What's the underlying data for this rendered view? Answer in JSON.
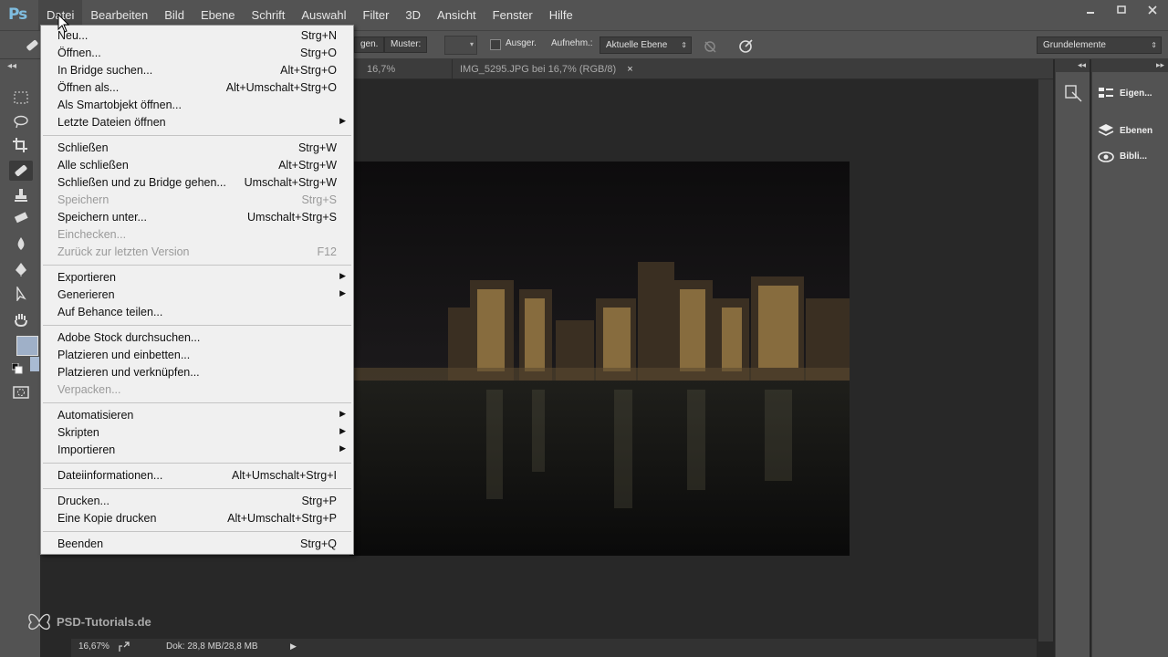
{
  "app": {
    "logo": "Ps"
  },
  "menubar": {
    "items": [
      "Datei",
      "Bearbeiten",
      "Bild",
      "Ebene",
      "Schrift",
      "Auswahl",
      "Filter",
      "3D",
      "Ansicht",
      "Fenster",
      "Hilfe"
    ],
    "active": "Datei"
  },
  "window_controls": {
    "minimize": "minimize-icon",
    "maximize": "maximize-icon",
    "close": "close-icon"
  },
  "optionsbar": {
    "partial_button": "gen.",
    "muster_button": "Muster:",
    "ausger_label": "Ausger.",
    "aufnehm_label": "Aufnehm.:",
    "sample_select": "Aktuelle Ebene",
    "workspace_select": "Grundelemente"
  },
  "tabs": [
    {
      "label": "16,7% (RGB/8)",
      "close": "×"
    },
    {
      "label": "IMG_5295.JPG bei 16,7% (RGB/8)",
      "close": "×"
    }
  ],
  "status": {
    "zoom": "16,67%",
    "doc_info": "Dok: 28,8 MB/28,8 MB"
  },
  "dock": {
    "panels": [
      {
        "label": "Eigen...",
        "icon": "properties-icon"
      },
      {
        "label": "Ebenen",
        "icon": "layers-icon"
      },
      {
        "label": "Bibli...",
        "icon": "libraries-icon"
      }
    ]
  },
  "file_menu": {
    "groups": [
      [
        {
          "label": "Neu...",
          "shortcut": "Strg+N",
          "enabled": true
        },
        {
          "label": "Öffnen...",
          "shortcut": "Strg+O",
          "enabled": true
        },
        {
          "label": "In Bridge suchen...",
          "shortcut": "Alt+Strg+O",
          "enabled": true
        },
        {
          "label": "Öffnen als...",
          "shortcut": "Alt+Umschalt+Strg+O",
          "enabled": true
        },
        {
          "label": "Als Smartobjekt öffnen...",
          "shortcut": "",
          "enabled": true
        },
        {
          "label": "Letzte Dateien öffnen",
          "shortcut": "",
          "enabled": true,
          "submenu": true
        }
      ],
      [
        {
          "label": "Schließen",
          "shortcut": "Strg+W",
          "enabled": true
        },
        {
          "label": "Alle schließen",
          "shortcut": "Alt+Strg+W",
          "enabled": true
        },
        {
          "label": "Schließen und zu Bridge gehen...",
          "shortcut": "Umschalt+Strg+W",
          "enabled": true
        },
        {
          "label": "Speichern",
          "shortcut": "Strg+S",
          "enabled": false
        },
        {
          "label": "Speichern unter...",
          "shortcut": "Umschalt+Strg+S",
          "enabled": true
        },
        {
          "label": "Einchecken...",
          "shortcut": "",
          "enabled": false
        },
        {
          "label": "Zurück zur letzten Version",
          "shortcut": "F12",
          "enabled": false
        }
      ],
      [
        {
          "label": "Exportieren",
          "shortcut": "",
          "enabled": true,
          "submenu": true
        },
        {
          "label": "Generieren",
          "shortcut": "",
          "enabled": true,
          "submenu": true
        },
        {
          "label": "Auf Behance teilen...",
          "shortcut": "",
          "enabled": true
        }
      ],
      [
        {
          "label": "Adobe Stock durchsuchen...",
          "shortcut": "",
          "enabled": true
        },
        {
          "label": "Platzieren und einbetten...",
          "shortcut": "",
          "enabled": true
        },
        {
          "label": "Platzieren und verknüpfen...",
          "shortcut": "",
          "enabled": true
        },
        {
          "label": "Verpacken...",
          "shortcut": "",
          "enabled": false
        }
      ],
      [
        {
          "label": "Automatisieren",
          "shortcut": "",
          "enabled": true,
          "submenu": true
        },
        {
          "label": "Skripten",
          "shortcut": "",
          "enabled": true,
          "submenu": true
        },
        {
          "label": "Importieren",
          "shortcut": "",
          "enabled": true,
          "submenu": true
        }
      ],
      [
        {
          "label": "Dateiinformationen...",
          "shortcut": "Alt+Umschalt+Strg+I",
          "enabled": true
        }
      ],
      [
        {
          "label": "Drucken...",
          "shortcut": "Strg+P",
          "enabled": true
        },
        {
          "label": "Eine Kopie drucken",
          "shortcut": "Alt+Umschalt+Strg+P",
          "enabled": true
        }
      ],
      [
        {
          "label": "Beenden",
          "shortcut": "Strg+Q",
          "enabled": true
        }
      ]
    ]
  },
  "watermark": {
    "text": "PSD-Tutorials.de"
  },
  "colors": {
    "fg": "#9fb0c8",
    "bg": "#a9bbd3",
    "accent": "#7fbde0"
  }
}
